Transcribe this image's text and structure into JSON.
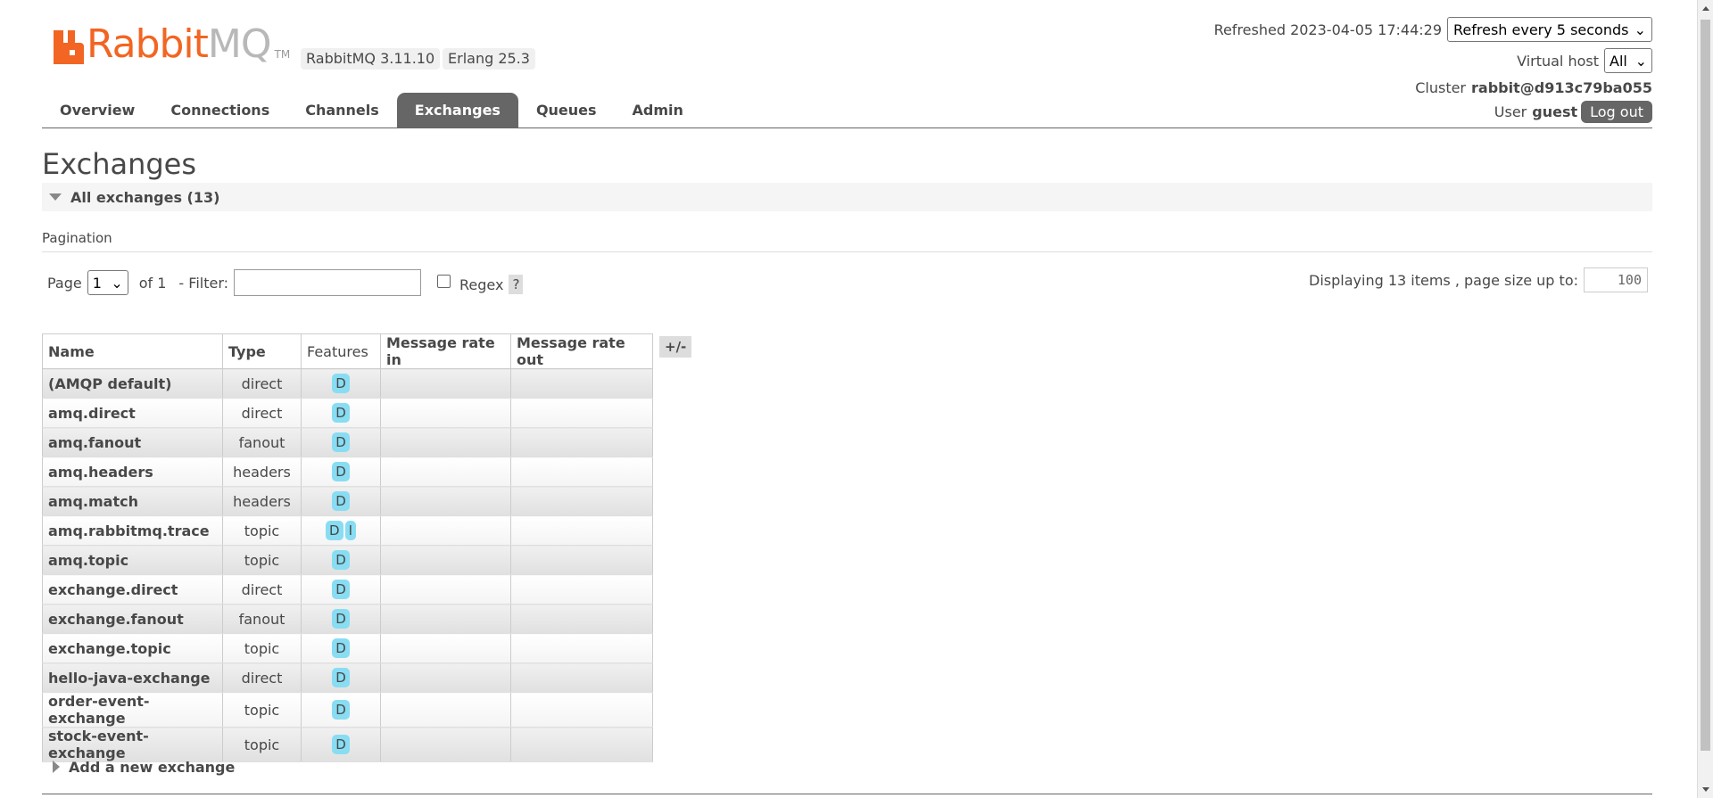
{
  "header": {
    "logo_rabbit": "Rabbit",
    "logo_mq": "MQ",
    "logo_tm": "TM",
    "rabbitmq_version": "RabbitMQ 3.11.10",
    "erlang_version": "Erlang 25.3",
    "refreshed_label": "Refreshed 2023-04-05 17:44:29",
    "refresh_select_value": "Refresh every 5 seconds",
    "vhost_label": "Virtual host",
    "vhost_value": "All",
    "cluster_label": "Cluster",
    "cluster_value": "rabbit@d913c79ba055",
    "user_label": "User",
    "user_value": "guest",
    "logout_label": "Log out"
  },
  "tabs": [
    {
      "label": "Overview",
      "active": false
    },
    {
      "label": "Connections",
      "active": false
    },
    {
      "label": "Channels",
      "active": false
    },
    {
      "label": "Exchanges",
      "active": true
    },
    {
      "label": "Queues",
      "active": false
    },
    {
      "label": "Admin",
      "active": false
    }
  ],
  "page": {
    "title": "Exchanges",
    "all_exchanges_label": "All exchanges (13)",
    "pagination_label": "Pagination",
    "page_label": "Page",
    "page_value": "1",
    "of_label": "of 1",
    "filter_label": "- Filter:",
    "filter_value": "",
    "regex_label": "Regex",
    "help_label": "?",
    "displaying_label": "Displaying 13 items , page size up to:",
    "page_size_value": "100",
    "add_exchange_label": "Add a new exchange",
    "column_toggle": "+/-"
  },
  "table": {
    "headers": {
      "name": "Name",
      "type": "Type",
      "features": "Features",
      "rate_in": "Message rate in",
      "rate_out": "Message rate out"
    },
    "rows": [
      {
        "name": "(AMQP default)",
        "type": "direct",
        "features": [
          "D"
        ]
      },
      {
        "name": "amq.direct",
        "type": "direct",
        "features": [
          "D"
        ]
      },
      {
        "name": "amq.fanout",
        "type": "fanout",
        "features": [
          "D"
        ]
      },
      {
        "name": "amq.headers",
        "type": "headers",
        "features": [
          "D"
        ]
      },
      {
        "name": "amq.match",
        "type": "headers",
        "features": [
          "D"
        ]
      },
      {
        "name": "amq.rabbitmq.trace",
        "type": "topic",
        "features": [
          "D",
          "I"
        ]
      },
      {
        "name": "amq.topic",
        "type": "topic",
        "features": [
          "D"
        ]
      },
      {
        "name": "exchange.direct",
        "type": "direct",
        "features": [
          "D"
        ]
      },
      {
        "name": "exchange.fanout",
        "type": "fanout",
        "features": [
          "D"
        ]
      },
      {
        "name": "exchange.topic",
        "type": "topic",
        "features": [
          "D"
        ]
      },
      {
        "name": "hello-java-exchange",
        "type": "direct",
        "features": [
          "D"
        ]
      },
      {
        "name": "order-event-exchange",
        "type": "topic",
        "features": [
          "D"
        ]
      },
      {
        "name": "stock-event-exchange",
        "type": "topic",
        "features": [
          "D"
        ]
      }
    ]
  },
  "colors": {
    "brand_orange": "#f26522",
    "active_tab": "#666666",
    "feature_badge": "#88ddf3"
  }
}
